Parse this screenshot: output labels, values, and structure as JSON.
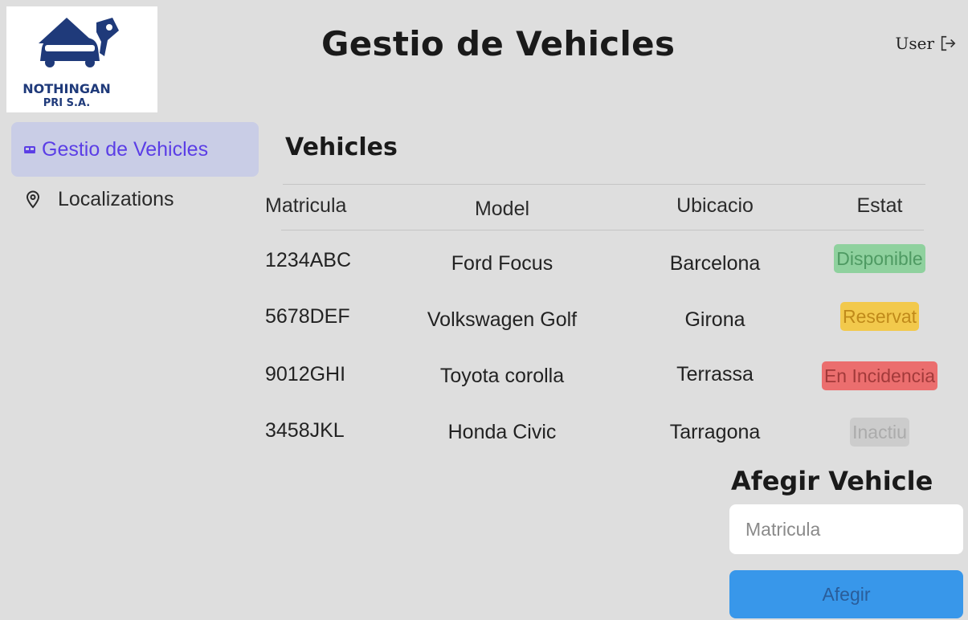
{
  "header": {
    "logo_line1": "NOTHINGAN",
    "logo_line2": "PRI S.A.",
    "title": "Gestio de Vehicles",
    "user_label": "User",
    "logout_icon": "logout-icon"
  },
  "sidebar": {
    "items": [
      {
        "label": "Gestio de Vehicles",
        "icon": "car-icon",
        "active": true
      },
      {
        "label": "Localizations",
        "icon": "map-pin-icon",
        "active": false
      }
    ]
  },
  "main": {
    "section_title": "Vehicles",
    "table": {
      "columns": [
        "Matricula",
        "Model",
        "Ubicacio",
        "Estat"
      ],
      "rows": [
        {
          "matricula": "1234ABC",
          "model": "Ford Focus",
          "ubicacio": "Barcelona",
          "estat": "Disponible"
        },
        {
          "matricula": "5678DEF",
          "model": "Volkswagen Golf",
          "ubicacio": "Girona",
          "estat": "Reservat"
        },
        {
          "matricula": "9012GHI",
          "model": "Toyota corolla",
          "ubicacio": "Terrassa",
          "estat": "En Incidencia"
        },
        {
          "matricula": "3458JKL",
          "model": "Honda Civic",
          "ubicacio": "Tarragona",
          "estat": "Inactiu"
        }
      ]
    },
    "status_colors": {
      "Disponible": {
        "bg": "#8fd19e",
        "fg": "#4e9a62"
      },
      "Reservat": {
        "bg": "#f2c94c",
        "fg": "#c08a1a"
      },
      "En Incidencia": {
        "bg": "#eb6e6e",
        "fg": "#a23a3a"
      },
      "Inactiu": {
        "bg": "#cccccc",
        "fg": "#ababab"
      }
    }
  },
  "add_vehicle": {
    "title": "Afegir Vehicle",
    "input_placeholder": "Matricula",
    "input_value": "",
    "button_label": "Afegir"
  },
  "colors": {
    "accent": "#5b3ee6",
    "active_nav_bg": "#c9cde6",
    "button_bg": "#3897ea",
    "logo_blue": "#1f3a7a"
  }
}
